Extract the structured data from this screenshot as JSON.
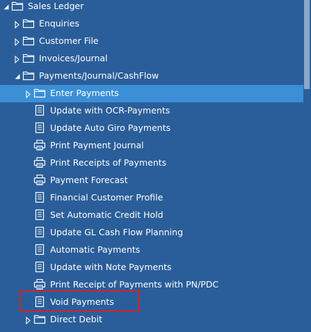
{
  "tree": {
    "items": [
      {
        "label": "Sales Ledger",
        "type": "folder",
        "state": "expanded",
        "level": 0
      },
      {
        "label": "Enquiries",
        "type": "folder",
        "state": "collapsed",
        "level": 1
      },
      {
        "label": "Customer File",
        "type": "folder",
        "state": "collapsed",
        "level": 1
      },
      {
        "label": "Invoices/Journal",
        "type": "folder",
        "state": "collapsed",
        "level": 1
      },
      {
        "label": "Payments/Journal/CashFlow",
        "type": "folder",
        "state": "expanded",
        "level": 1
      },
      {
        "label": "Enter Payments",
        "type": "folder",
        "state": "collapsed",
        "level": 2,
        "selected": true
      },
      {
        "label": "Update with OCR-Payments",
        "type": "document",
        "level": 2
      },
      {
        "label": "Update Auto Giro Payments",
        "type": "document",
        "level": 2
      },
      {
        "label": "Print Payment Journal",
        "type": "printer",
        "level": 2
      },
      {
        "label": "Print Receipts of Payments",
        "type": "printer",
        "level": 2
      },
      {
        "label": "Payment Forecast",
        "type": "printer",
        "level": 2
      },
      {
        "label": "Financial Customer Profile",
        "type": "document",
        "level": 2
      },
      {
        "label": "Set Automatic Credit Hold",
        "type": "document",
        "level": 2
      },
      {
        "label": "Update GL Cash Flow Planning",
        "type": "document",
        "level": 2
      },
      {
        "label": "Automatic Payments",
        "type": "document",
        "level": 2
      },
      {
        "label": "Update with Note Payments",
        "type": "document",
        "level": 2
      },
      {
        "label": "Print Receipt of Payments with PN/PDC",
        "type": "printer",
        "level": 2
      },
      {
        "label": "Void Payments",
        "type": "document",
        "level": 2,
        "highlighted": true
      },
      {
        "label": "Direct Debit",
        "type": "folder",
        "state": "collapsed",
        "level": 2
      }
    ]
  },
  "colors": {
    "background": "#2a5e9a",
    "selected_row": "#3b8fd6",
    "highlight_border": "#d62027",
    "text": "#ffffff"
  },
  "icons": {
    "folder": "folder-icon",
    "document": "document-icon",
    "printer": "printer-icon",
    "expanded": "expanded-arrow-icon",
    "collapsed": "collapsed-arrow-icon"
  }
}
